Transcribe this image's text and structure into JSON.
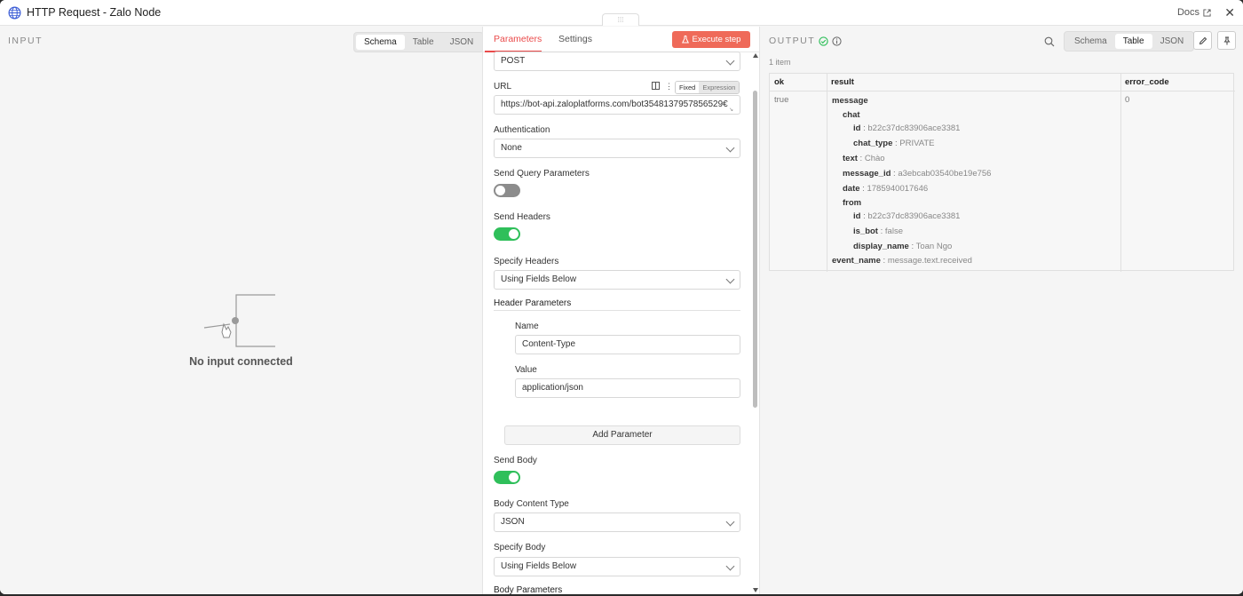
{
  "window": {
    "title": "HTTP Request - Zalo Node",
    "docs_label": "Docs",
    "close": "✕",
    "drag_handle": "⁞⁞⁞"
  },
  "input_panel": {
    "heading": "INPUT",
    "view_tabs": [
      "Schema",
      "Table",
      "JSON"
    ],
    "active_view": "Schema",
    "empty_message": "No input connected"
  },
  "params_panel": {
    "tabs": [
      "Parameters",
      "Settings"
    ],
    "active_tab": "Parameters",
    "execute_label": "Execute step",
    "method": {
      "value": "POST"
    },
    "url": {
      "label": "URL",
      "value": "https://bot-api.zaloplatforms.com/bot3548137957856529€",
      "fixed_label": "Fixed",
      "expression_label": "Expression"
    },
    "authentication": {
      "label": "Authentication",
      "value": "None"
    },
    "send_query": {
      "label": "Send Query Parameters",
      "enabled": false
    },
    "send_headers": {
      "label": "Send Headers",
      "enabled": true
    },
    "specify_headers": {
      "label": "Specify Headers",
      "value": "Using Fields Below"
    },
    "header_parameters": {
      "title": "Header Parameters",
      "name_label": "Name",
      "name_value": "Content-Type",
      "value_label": "Value",
      "value_value": "application/json",
      "add_label": "Add Parameter"
    },
    "send_body": {
      "label": "Send Body",
      "enabled": true
    },
    "body_content_type": {
      "label": "Body Content Type",
      "value": "JSON"
    },
    "specify_body": {
      "label": "Specify Body",
      "value": "Using Fields Below"
    },
    "body_parameters": {
      "title": "Body Parameters"
    }
  },
  "output_panel": {
    "heading": "OUTPUT",
    "view_tabs": [
      "Schema",
      "Table",
      "JSON"
    ],
    "active_view": "Table",
    "items_count": "1 item",
    "columns": [
      "ok",
      "result",
      "error_code"
    ],
    "row": {
      "ok": "true",
      "error_code": "0",
      "result": {
        "message": "message",
        "chat": "chat",
        "chat_id_key": "id",
        "chat_id": "b22c37dc83906ace3381",
        "chat_type_key": "chat_type",
        "chat_type": "PRIVATE",
        "text_key": "text",
        "text": "Chào",
        "message_id_key": "message_id",
        "message_id": "a3ebcab03540be19e756",
        "date_key": "date",
        "date": "1785940017646",
        "from": "from",
        "from_id_key": "id",
        "from_id": "b22c37dc83906ace3381",
        "is_bot_key": "is_bot",
        "is_bot": "false",
        "display_name_key": "display_name",
        "display_name": "Toan Ngo",
        "event_name_key": "event_name",
        "event_name": "message.text.received"
      }
    }
  },
  "colors": {
    "accent": "#ea4b4b",
    "execute": "#ef6a59",
    "toggle_on": "#2fbf5a",
    "status_ok": "#2fbf5a"
  }
}
